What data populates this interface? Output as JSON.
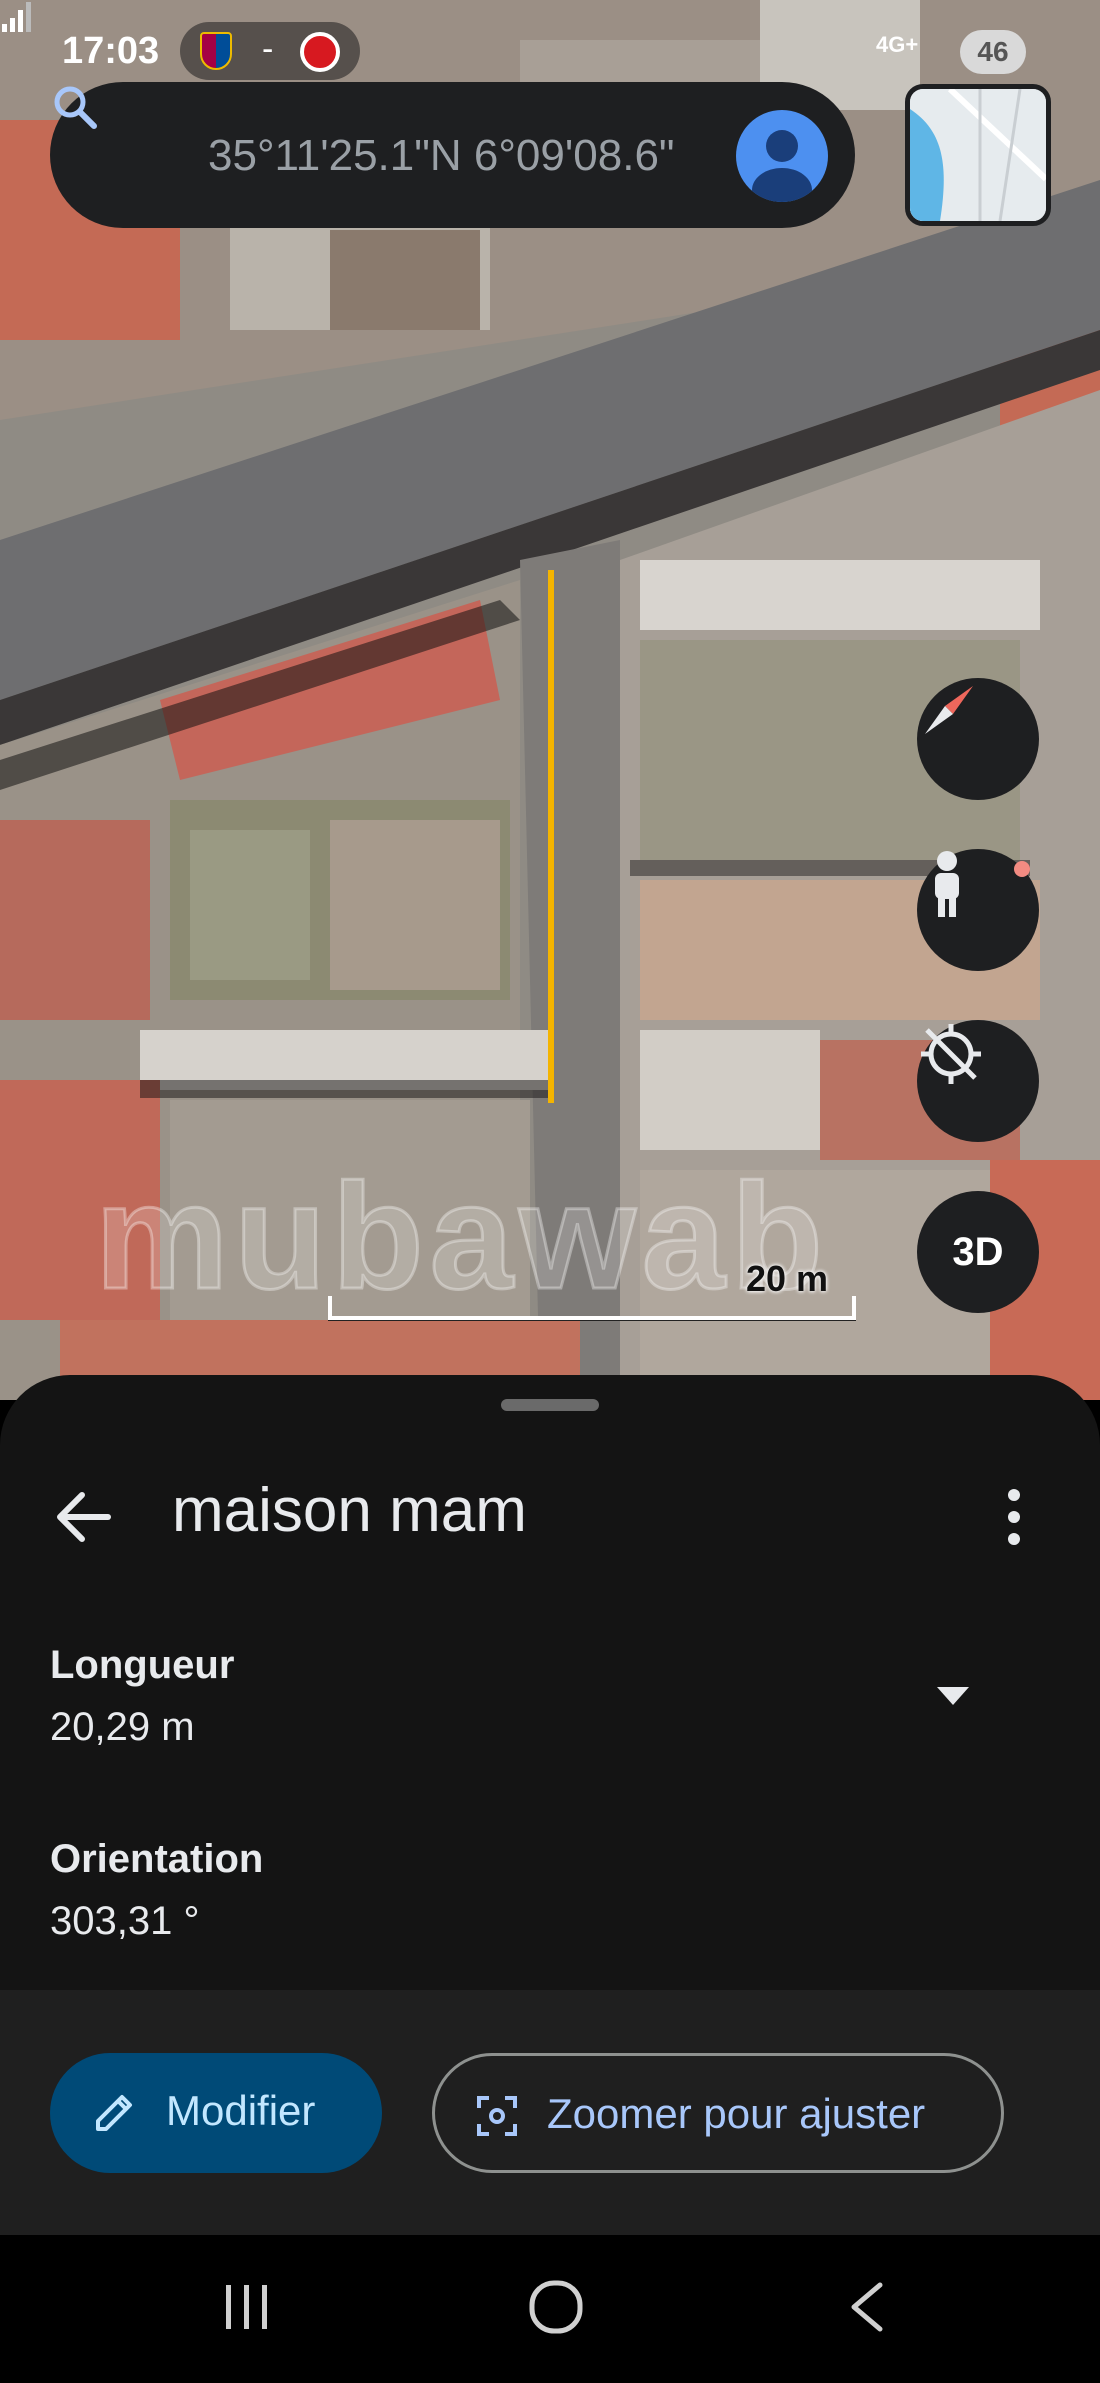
{
  "status_bar": {
    "time": "17:03",
    "separator": "-",
    "network": "4G+",
    "battery": "46"
  },
  "search": {
    "query": "35°11'25.1\"N 6°09'08.6\""
  },
  "map": {
    "watermark": "mubawab",
    "scale_label": "20 m",
    "measure_line_color": "#f4b400",
    "three_d_label": "3D"
  },
  "sheet": {
    "title": "maison mam",
    "length_label": "Longueur",
    "length_value": "20,29 m",
    "orientation_label": "Orientation",
    "orientation_value": "303,31 °"
  },
  "actions": {
    "modify_label": "Modifier",
    "zoom_label": "Zoomer pour ajuster"
  },
  "colors": {
    "primary_button": "#004a77",
    "primary_text": "#c2e7ff",
    "link_blue": "#a8c7fa",
    "sheet_bg": "#141414"
  }
}
